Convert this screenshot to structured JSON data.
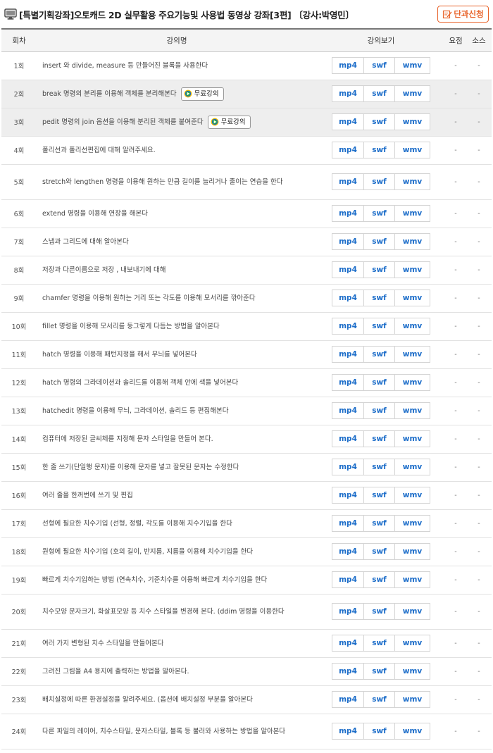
{
  "header": {
    "title": "[특별기획강좌]오토캐드 2D 실무활용 주요기능및 사용법 동영상 강좌[3편] 〔강사:박영민〕",
    "apply_label": "단과신청"
  },
  "columns": [
    "회차",
    "강의명",
    "강의보기",
    "요점",
    "소스"
  ],
  "format_labels": [
    "mp4",
    "swf",
    "wmv"
  ],
  "free_label": "무료강의",
  "empty_mark": "-",
  "colors": {
    "accent": "#e8632a",
    "link": "#1c6dc9",
    "free_row_bg": "#eeeeee"
  },
  "lectures": [
    {
      "no": "1회",
      "title": "insert 와 divide, measure 등 만들어진 블록을 사용한다",
      "free": false
    },
    {
      "no": "2회",
      "title": "break 명령의 분리를 이용해 객체를 분리해본다",
      "free": true
    },
    {
      "no": "3회",
      "title": "pedit 명령의 join 옵션을 이용해 분리된 객체를 붙여준다",
      "free": true
    },
    {
      "no": "4회",
      "title": "폴리선과 폴리선편집에 대해 알려주세요.",
      "free": false
    },
    {
      "no": "5회",
      "title": "stretch와 lengthen 명령을 이용해 원하는 만큼 길이를 늘리거나 줄이는 연습을 한다",
      "free": false
    },
    {
      "no": "6회",
      "title": "extend 명령을 이용해 연장을 해본다",
      "free": false
    },
    {
      "no": "7회",
      "title": "스냅과 그리드에 대해 알아본다",
      "free": false
    },
    {
      "no": "8회",
      "title": "저장과 다른이름으로 저장 , 내보내기에 대해",
      "free": false
    },
    {
      "no": "9회",
      "title": "chamfer 명령을 이용해 원하는 거리 또는 각도를 이용해 모서리를 깎아준다",
      "free": false
    },
    {
      "no": "10회",
      "title": "fillet 명령을 이용해 모서리를 둥그렇게 다듬는 방법을 알아본다",
      "free": false
    },
    {
      "no": "11회",
      "title": "hatch 명령을 이용해 패턴지정을 해서 무늬를 넣어본다",
      "free": false
    },
    {
      "no": "12회",
      "title": "hatch 명령의 그라데이션과 솔리드를 이용해 객체 안에 색을 넣어본다",
      "free": false
    },
    {
      "no": "13회",
      "title": "hatchedit 명령을 이용해 무늬, 그라데이션, 솔리드 등 편집해본다",
      "free": false
    },
    {
      "no": "14회",
      "title": "컴퓨터에 저장된 글씨체를 지정해 문자 스타일을 만들어 본다.",
      "free": false
    },
    {
      "no": "15회",
      "title": "한 줄 쓰기(단일행 문자)를 이용해 문자를 넣고 잘못된 문자는 수정한다",
      "free": false
    },
    {
      "no": "16회",
      "title": "여러 줄을 한꺼번에 쓰기 및 편집",
      "free": false
    },
    {
      "no": "17회",
      "title": "선형에 필요한 치수기입 (선형, 정렬, 각도를 이용해 치수기입을 한다",
      "free": false
    },
    {
      "no": "18회",
      "title": "원형에 필요한 치수기입 (호의 길이, 반지름, 지름을 이용해 치수기입을 한다",
      "free": false
    },
    {
      "no": "19회",
      "title": "빠르게 치수기입하는 방법 (연속치수, 기준치수를 이용해 빠르게 치수기입을 한다",
      "free": false
    },
    {
      "no": "20회",
      "title": "치수모양 문자크기, 화살표모양 등 치수 스타일을 변경해 본다. (ddim 명령을 이용한다",
      "free": false
    },
    {
      "no": "21회",
      "title": "여러 가지 변형된 치수 스타일을 만들어본다",
      "free": false
    },
    {
      "no": "22회",
      "title": "그려진 그림을 A4 용지에 출력하는 방법을 알아본다.",
      "free": false
    },
    {
      "no": "23회",
      "title": "배치설정에 따른 환경설정을 알려주세요. (옵션에 배치설정 부분을 알아본다",
      "free": false
    },
    {
      "no": "24회",
      "title": "다른 파일의 레이어, 치수스타일, 문자스타일, 블록 등 불러와 사용하는 방법을 알아본다",
      "free": false
    }
  ]
}
